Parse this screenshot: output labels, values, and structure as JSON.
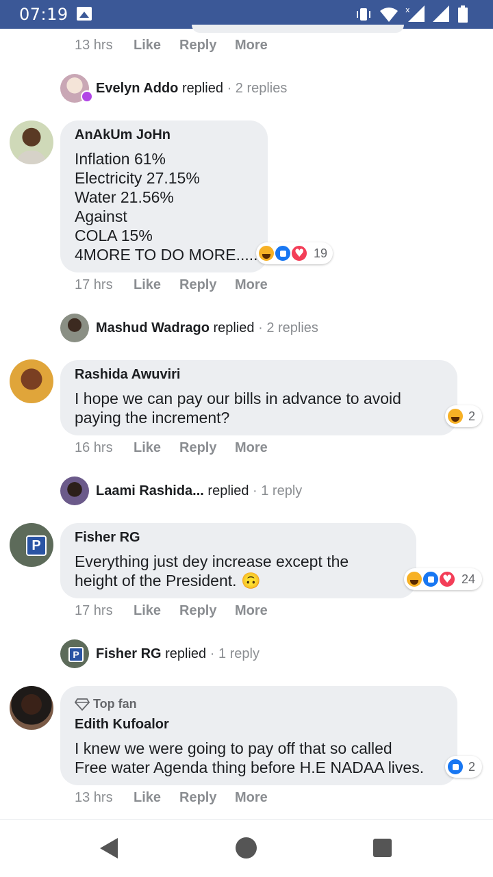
{
  "status_bar": {
    "time": "07:19"
  },
  "actions": {
    "like": "Like",
    "reply": "Reply",
    "more": "More"
  },
  "top_meta": {
    "time": "13 hrs"
  },
  "comments": [
    {
      "replied_above": {
        "name": "Evelyn Addo",
        "verb": "replied",
        "count": "· 2 replies"
      },
      "author": "AnAkUm JoHn",
      "text": "Inflation 61%\nElectricity 27.15%\nWater 21.56%\nAgainst\nCOLA 15%\n4MORE TO DO MORE.....",
      "reactions": {
        "types": [
          "haha",
          "like",
          "love"
        ],
        "count": "19"
      },
      "time": "17 hrs"
    },
    {
      "replied_above": {
        "name": "Mashud Wadrago",
        "verb": "replied",
        "count": "· 2 replies"
      },
      "author": "Rashida Awuviri",
      "text": "I hope we can pay our bills in advance to avoid\npaying the increment?",
      "reactions": {
        "types": [
          "haha"
        ],
        "count": "2"
      },
      "time": "16 hrs"
    },
    {
      "replied_above": {
        "name": "Laami Rashida...",
        "verb": "replied",
        "count": "· 1 reply"
      },
      "author": "Fisher RG",
      "text": "Everything just dey increase except the\nheight of the President. 🙃",
      "reactions": {
        "types": [
          "haha",
          "like",
          "love"
        ],
        "count": "24"
      },
      "time": "17 hrs"
    },
    {
      "replied_above": {
        "name": "Fisher RG",
        "verb": "replied",
        "count": "· 1 reply"
      },
      "badge": "Top fan",
      "author": "Edith Kufoalor",
      "text": "I knew we were going to pay off that so called\nFree water Agenda thing before H.E NADAA lives.",
      "reactions": {
        "types": [
          "like"
        ],
        "count": "2"
      },
      "time": "13 hrs"
    }
  ],
  "colors": {
    "status_bar": "#3b5897",
    "bubble": "#eceef1",
    "meta": "#8a8d91"
  }
}
